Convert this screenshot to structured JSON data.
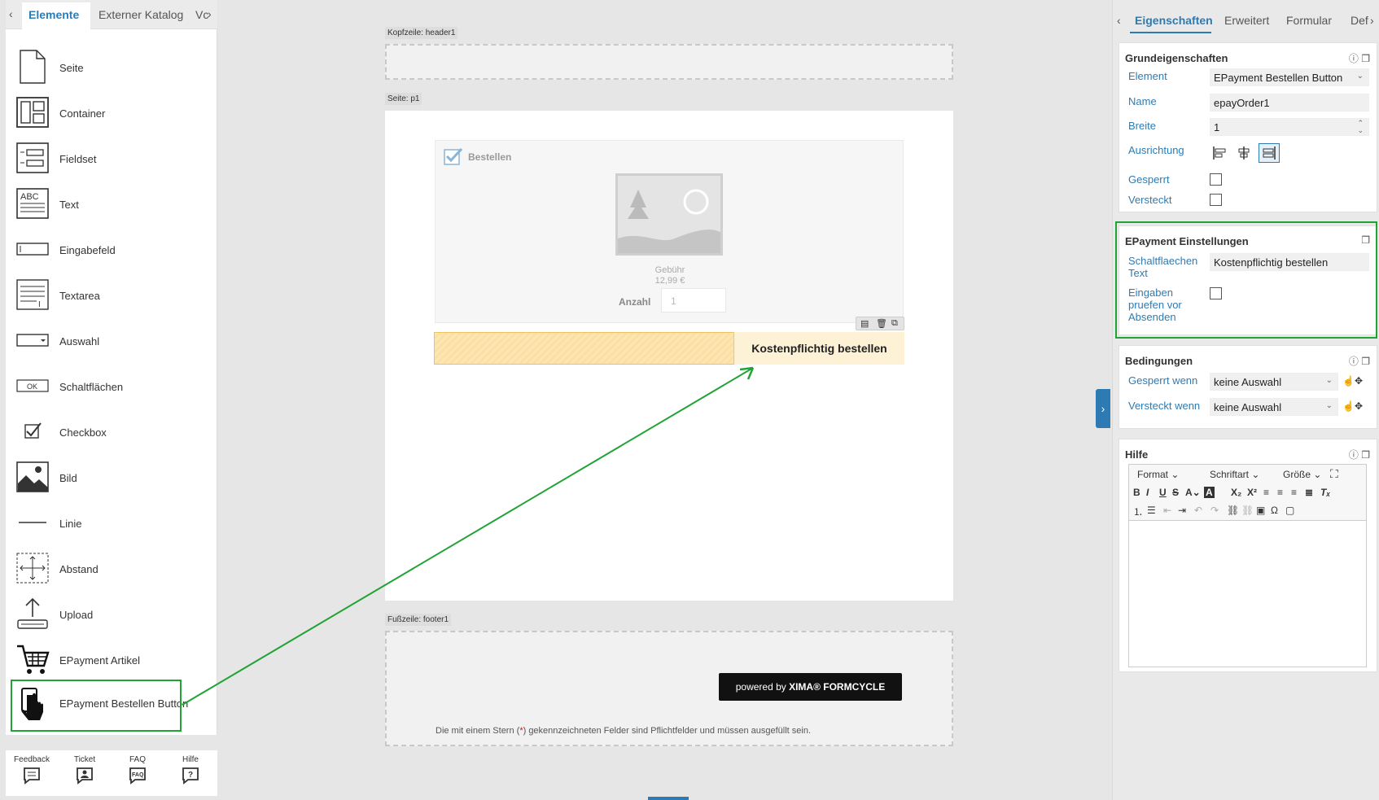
{
  "left_panel": {
    "tabs": [
      "Elemente",
      "Externer Katalog",
      "Vc"
    ],
    "elements": [
      {
        "label": "Seite",
        "icon": "page-icon"
      },
      {
        "label": "Container",
        "icon": "container-icon"
      },
      {
        "label": "Fieldset",
        "icon": "fieldset-icon"
      },
      {
        "label": "Text",
        "icon": "text-icon"
      },
      {
        "label": "Eingabefeld",
        "icon": "input-field-icon"
      },
      {
        "label": "Textarea",
        "icon": "textarea-icon"
      },
      {
        "label": "Auswahl",
        "icon": "select-icon"
      },
      {
        "label": "Schaltflächen",
        "icon": "button-icon"
      },
      {
        "label": "Checkbox",
        "icon": "checkbox-icon"
      },
      {
        "label": "Bild",
        "icon": "image-icon"
      },
      {
        "label": "Linie",
        "icon": "line-icon"
      },
      {
        "label": "Abstand",
        "icon": "spacing-icon"
      },
      {
        "label": "Upload",
        "icon": "upload-icon"
      },
      {
        "label": "EPayment Artikel",
        "icon": "shopping-cart-icon"
      },
      {
        "label": "EPayment Bestellen Button",
        "icon": "hand-click-icon"
      }
    ],
    "bottom": [
      {
        "label": "Feedback",
        "icon": "feedback-icon"
      },
      {
        "label": "Ticket",
        "icon": "ticket-icon"
      },
      {
        "label": "FAQ",
        "icon": "faq-icon"
      },
      {
        "label": "Hilfe",
        "icon": "help-icon"
      }
    ]
  },
  "canvas": {
    "header_label": "Kopfzeile: header1",
    "page_label": "Seite: p1",
    "footer_label": "Fußzeile: footer1",
    "card_title": "Bestellen",
    "fee_label": "Gebühr",
    "fee_value": "12,99 €",
    "quantity_label": "Anzahl",
    "quantity_value": "1",
    "order_button": "Kostenpflichtig bestellen",
    "powered_by_prefix": "powered by ",
    "powered_by_brand": "XIMA® FORMCYCLE",
    "footer_note_pre": "Die mit einem Stern (",
    "footer_note_star": "*",
    "footer_note_post": ") gekennzeichneten Felder sind Pflichtfelder und müssen ausgefüllt sein."
  },
  "right_panel": {
    "tabs": [
      "Eigenschaften",
      "Erweitert",
      "Formular",
      "Def"
    ],
    "basic": {
      "title": "Grundeigenschaften",
      "element_label": "Element",
      "element_value": "EPayment Bestellen Button",
      "name_label": "Name",
      "name_value": "epayOrder1",
      "width_label": "Breite",
      "width_value": "1",
      "align_label": "Ausrichtung",
      "locked_label": "Gesperrt",
      "hidden_label": "Versteckt"
    },
    "epayment": {
      "title": "EPayment Einstellungen",
      "button_text_label": "Schaltflaechen Text",
      "button_text_value": "Kostenpflichtig bestellen",
      "validate_label": "Eingaben pruefen vor Absenden"
    },
    "conditions": {
      "title": "Bedingungen",
      "locked_when_label": "Gesperrt wenn",
      "locked_when_value": "keine Auswahl",
      "hidden_when_label": "Versteckt wenn",
      "hidden_when_value": "keine Auswahl"
    },
    "help": {
      "title": "Hilfe",
      "format": "Format",
      "font": "Schriftart",
      "size": "Größe"
    }
  },
  "colors": {
    "accent": "#2e7bb3",
    "highlight": "#21a336",
    "order_bar": "#fde6b3"
  }
}
